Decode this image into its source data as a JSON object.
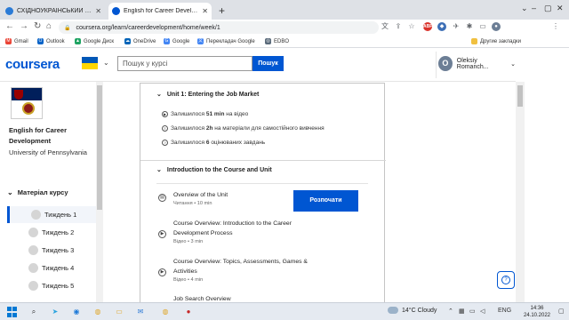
{
  "browser": {
    "tabs": [
      {
        "title": "СХІДНОУКРАЇНСЬКИЙ НАЦІОНА...",
        "active": false
      },
      {
        "title": "English for Career Development",
        "active": true
      }
    ],
    "url": "coursera.org/learn/careerdevelopment/home/week/1",
    "bookmarks": [
      "Gmail",
      "Outlook",
      "Google Диск",
      "OneDrive",
      "Google",
      "Перекладач Google",
      "EDBO"
    ],
    "other_bookmarks": "Другие закладки",
    "abp_badge": "ABP"
  },
  "coursera": {
    "logo": "coursera",
    "search_placeholder": "Пошук у курсі",
    "search_button": "Пошук",
    "user_initial": "O",
    "user_name": "Oleksiy Romanch...",
    "accent": "#0056d2"
  },
  "sidebar": {
    "course_title": "English for Career Development",
    "university": "University of Pennsylvania",
    "materials_label": "Матеріал курсу",
    "weeks": [
      "Тиждень 1",
      "Тиждень 2",
      "Тиждень 3",
      "Тиждень 4",
      "Тиждень 5"
    ]
  },
  "main": {
    "unit_title": "Unit 1: Entering the Job Market",
    "stats": [
      {
        "icon": "play-icon",
        "prefix": "Залишилося ",
        "bold": "51 min",
        "suffix": " на відео"
      },
      {
        "icon": "book-icon",
        "prefix": "Залишилося ",
        "bold": "2h",
        "suffix": " на матеріали для самостійного вивчення"
      },
      {
        "icon": "quiz-icon",
        "prefix": "Залишилося ",
        "bold": "6",
        "suffix": " оцінюваних завдань"
      }
    ],
    "lesson_title": "Introduction to the Course and Unit",
    "items": [
      {
        "icon": "reading-icon",
        "title": "Overview of the Unit",
        "meta": "Читання • 10 min"
      },
      {
        "icon": "video-icon",
        "title": "Course Overview: Introduction to the Career Development Process",
        "meta": "Відео • 3 min"
      },
      {
        "icon": "video-icon",
        "title": "Course Overview: Topics, Assessments, Games & Activities",
        "meta": "Відео • 4 min"
      },
      {
        "icon": "video-icon",
        "title": "Job Search Overview",
        "meta": ""
      }
    ],
    "start_button": "Розпочати"
  },
  "taskbar": {
    "weather_temp": "14°C",
    "weather_text": "Cloudy",
    "language": "ENG",
    "time": "14:36",
    "date": "24.10.2022"
  }
}
